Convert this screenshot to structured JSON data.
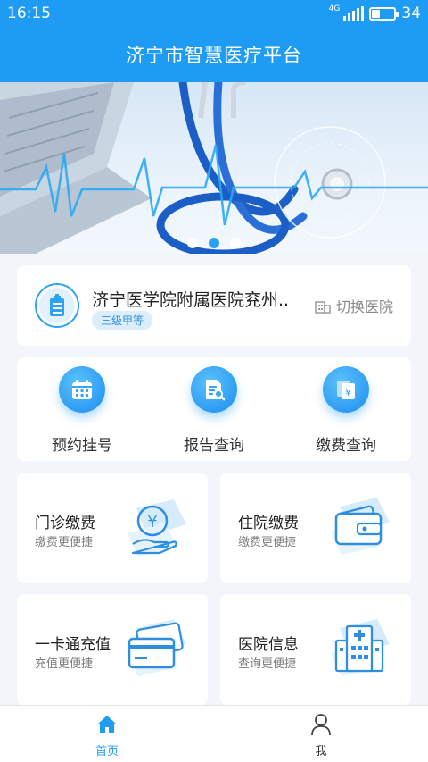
{
  "status_bar": {
    "time": "16:15",
    "network": "4G",
    "battery": "34",
    "battery_level": 0.34
  },
  "header": {
    "title": "济宁市智慧医疗平台"
  },
  "banner": {
    "slide_count": 3,
    "active_slide": 2
  },
  "hospital": {
    "name": "济宁医学院附属医院兖州..",
    "level": "三级甲等",
    "switch_label": "切换医院"
  },
  "quick_actions": [
    {
      "label": "预约挂号",
      "icon": "calendar-icon"
    },
    {
      "label": "报告查询",
      "icon": "report-search-icon"
    },
    {
      "label": "缴费查询",
      "icon": "payment-query-icon"
    }
  ],
  "tiles": [
    {
      "title": "门诊缴费",
      "subtitle": "缴费更便捷",
      "icon": "coin-hand-icon"
    },
    {
      "title": "住院缴费",
      "subtitle": "缴费更便捷",
      "icon": "wallet-icon"
    },
    {
      "title": "一卡通充值",
      "subtitle": "充值更便捷",
      "icon": "card-icon"
    },
    {
      "title": "医院信息",
      "subtitle": "查询更便捷",
      "icon": "hospital-building-icon"
    }
  ],
  "tabbar": [
    {
      "label": "首页",
      "icon": "home-icon",
      "active": true
    },
    {
      "label": "我",
      "icon": "user-icon",
      "active": false
    }
  ],
  "colors": {
    "primary": "#1e9cf4",
    "background": "#f2f6fa",
    "text": "#222222",
    "muted": "#7c7c7c"
  }
}
